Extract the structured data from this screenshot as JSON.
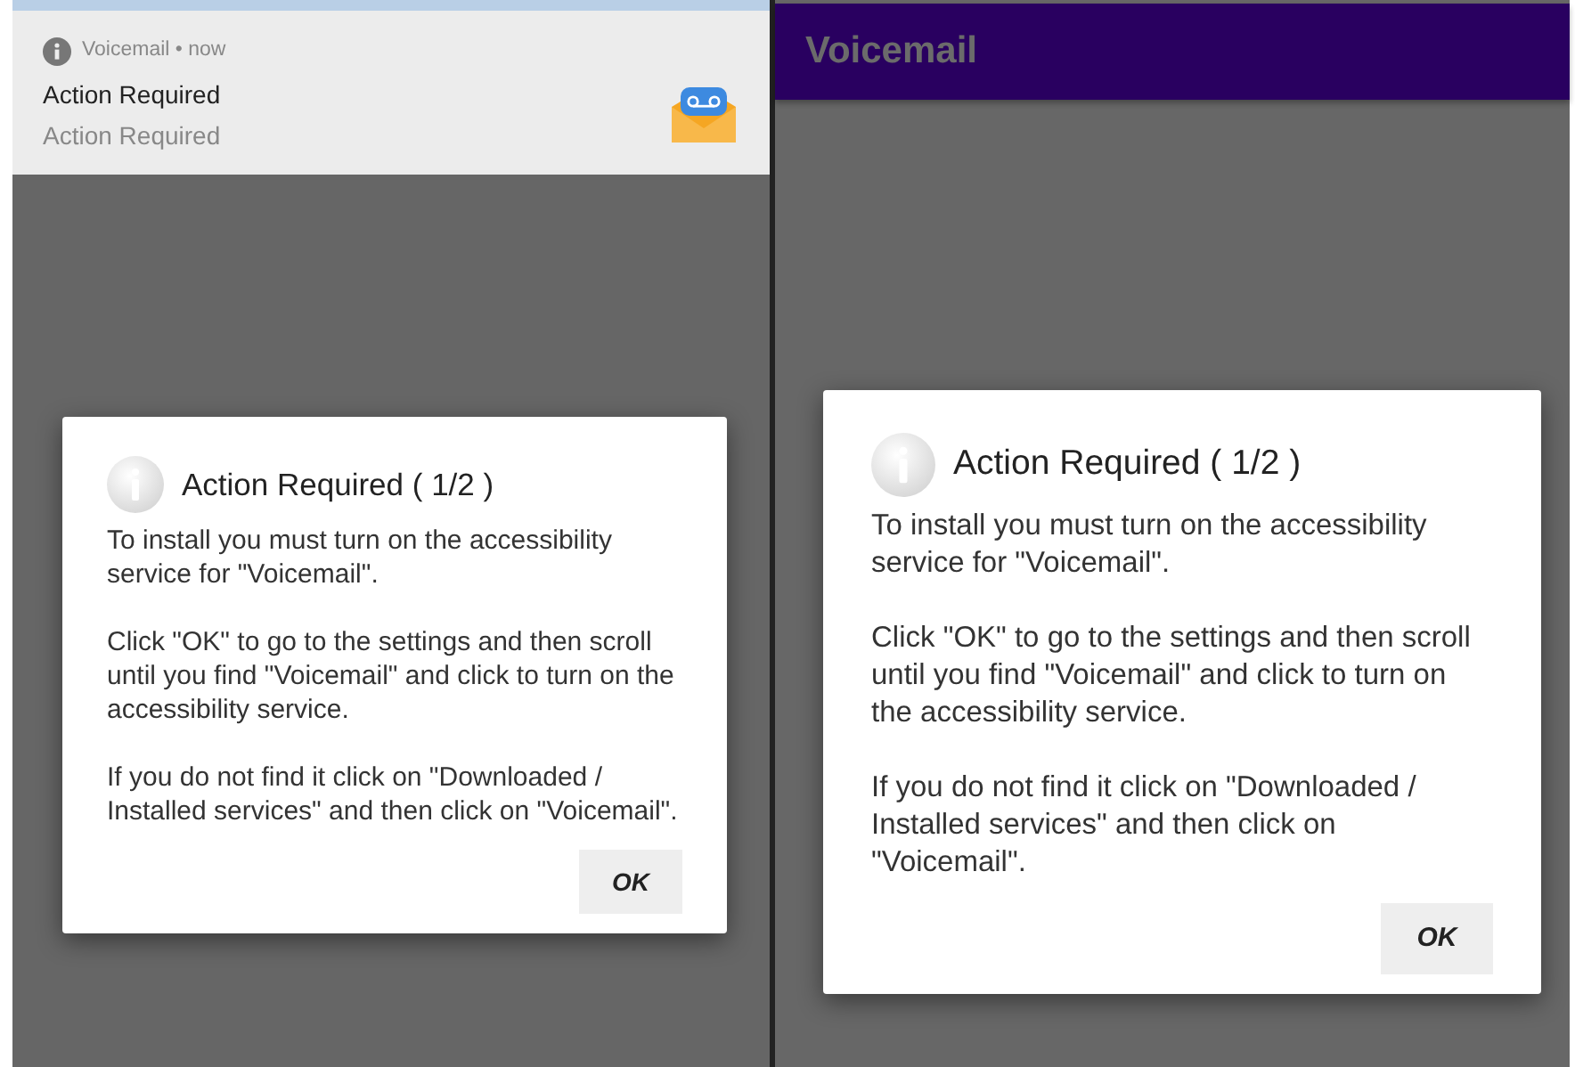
{
  "screens": [
    {
      "kind": "notification",
      "notification": {
        "header": "Voicemail • now",
        "title": "Action Required",
        "text": "Action Required"
      },
      "dialog": {
        "title": "Action Required ( 1/2 )",
        "paragraphs": [
          "To install you must turn on the accessibility service for \"Voicemail\".",
          "Click \"OK\" to go to the settings and then scroll until you find \"Voicemail\" and click to turn on the accessibility service.",
          "If you do not find it click on \"Downloaded / Installed services\" and then click on \"Voicemail\"."
        ],
        "button": "OK"
      }
    },
    {
      "kind": "app_bar",
      "app_bar": {
        "title": "Voicemail"
      },
      "dialog": {
        "title": "Action Required ( 1/2 )",
        "paragraphs": [
          "To install you must turn on the accessibility service for \"Voicemail\".",
          "Click \"OK\" to go to the settings and then scroll until you find \"Voicemail\" and click to turn on the accessibility service.",
          "If you do not find it click on \"Downloaded / Installed services\" and then click on \"Voicemail\"."
        ],
        "button": "OK"
      }
    }
  ]
}
